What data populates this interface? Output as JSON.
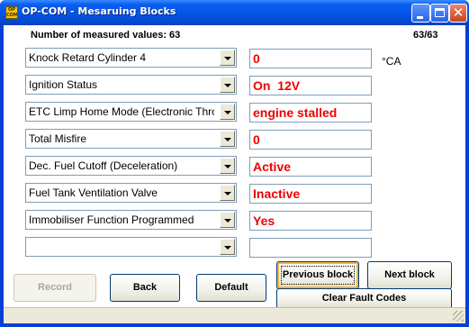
{
  "window": {
    "title": "OP-COM - Mesaruing Blocks",
    "icon_text": "OP COM",
    "icon_name": "opcom-app-icon"
  },
  "header": {
    "measured_count_label": "Number of measured values: 63",
    "page_indicator": "63/63"
  },
  "rows": [
    {
      "selector": "Knock Retard Cylinder 4",
      "value": "0",
      "unit": "°CA"
    },
    {
      "selector": "Ignition Status",
      "value": "On  12V",
      "unit": ""
    },
    {
      "selector": "ETC Limp Home Mode (Electronic Throt",
      "value": "engine stalled",
      "unit": ""
    },
    {
      "selector": "Total Misfire",
      "value": "0",
      "unit": ""
    },
    {
      "selector": "Dec. Fuel Cutoff (Deceleration)",
      "value": "Active",
      "unit": ""
    },
    {
      "selector": "Fuel Tank Ventilation Valve",
      "value": "Inactive",
      "unit": ""
    },
    {
      "selector": "Immobiliser Function Programmed",
      "value": "Yes",
      "unit": ""
    },
    {
      "selector": "",
      "value": "",
      "unit": ""
    }
  ],
  "buttons": {
    "record": "Record",
    "back": "Back",
    "default": "Default",
    "previous_block": "Previous block",
    "next_block": "Next block",
    "clear_fault_codes": "Clear Fault Codes"
  },
  "colors": {
    "value_text": "#ee0000",
    "title_bar": "#0455e5"
  }
}
